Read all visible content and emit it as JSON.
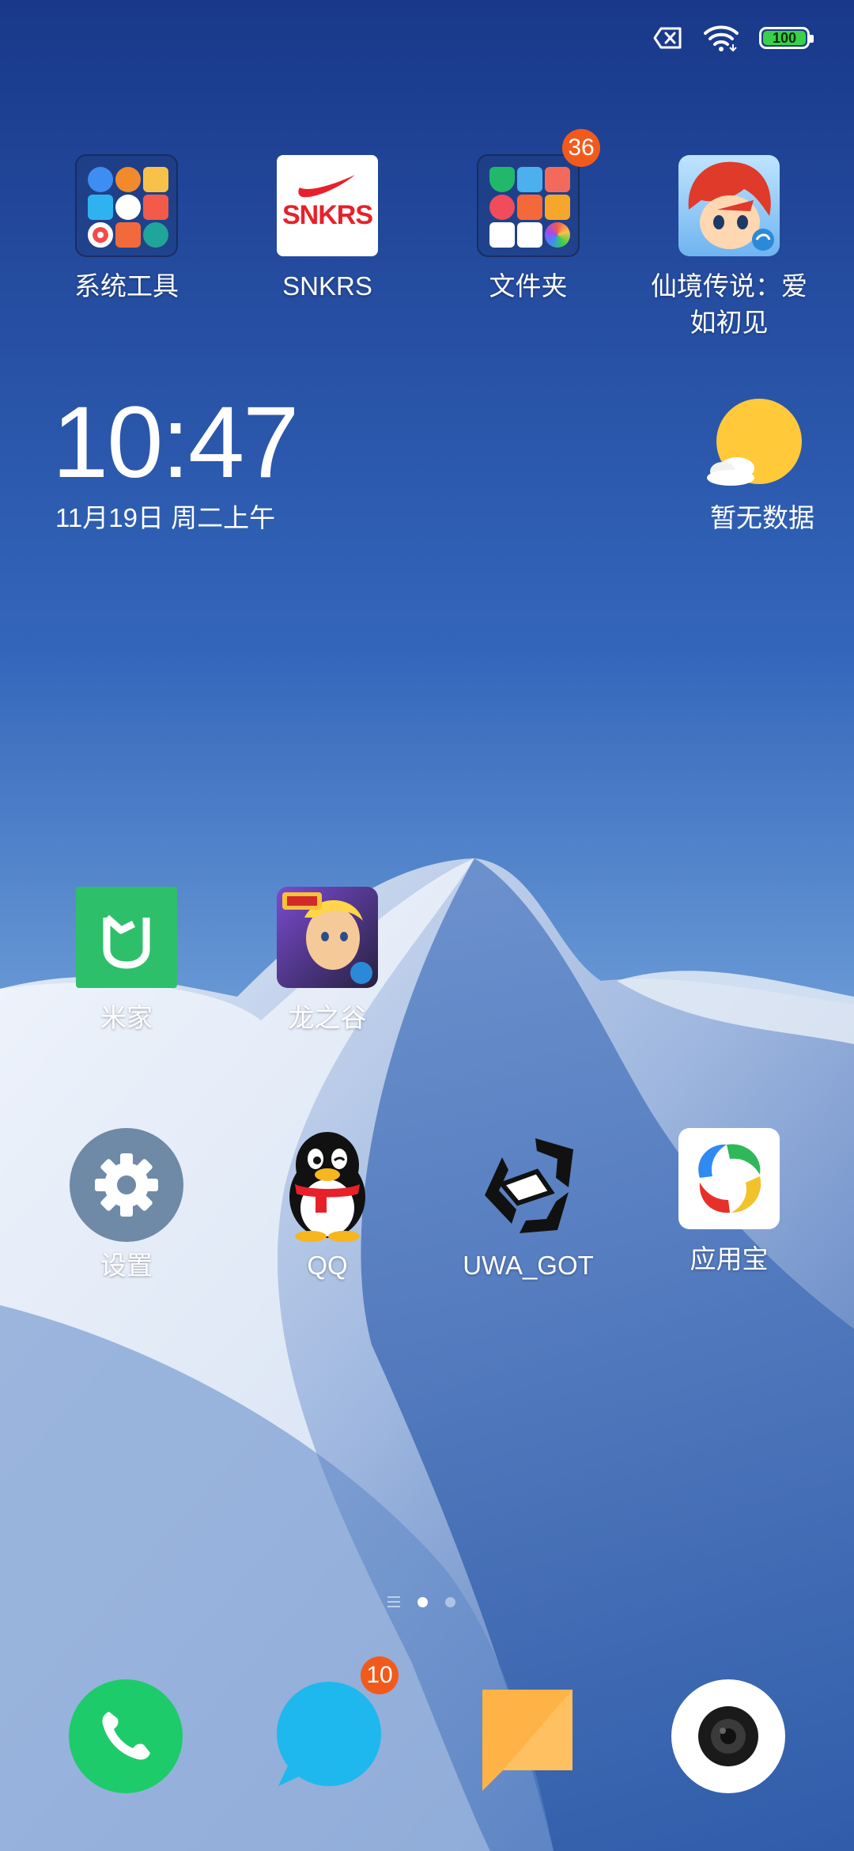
{
  "status_bar": {
    "battery_level": "100",
    "icons": [
      "sim-off-icon",
      "wifi-icon",
      "battery-icon"
    ]
  },
  "row1": {
    "folder1_label": "系统工具",
    "snkrs_label": "SNKRS",
    "snkrs_logo_text": "SNKRS",
    "folder2_label": "文件夹",
    "folder2_badge": "36",
    "game1_label": "仙境传说：爱如初见"
  },
  "clock": {
    "time": "10:47",
    "date": "11月19日 周二上午"
  },
  "weather": {
    "label": "暂无数据",
    "icon": "sun-cloud-icon"
  },
  "row2": {
    "mijia_label": "米家",
    "dragon_label": "龙之谷"
  },
  "row3": {
    "settings_label": "设置",
    "qq_label": "QQ",
    "unity_label": "UWA_GOT",
    "appstore_label": "应用宝"
  },
  "dock": {
    "messages_badge": "10",
    "apps": [
      "phone-icon",
      "messages-icon",
      "notes-icon",
      "camera-icon"
    ]
  },
  "colors": {
    "badge": "#f25a1c",
    "phone": "#1ecb6a",
    "messages": "#1eb8ee",
    "notes": "#ffb347",
    "mijia": "#2ebf6a",
    "settings": "#6f8aa6"
  }
}
